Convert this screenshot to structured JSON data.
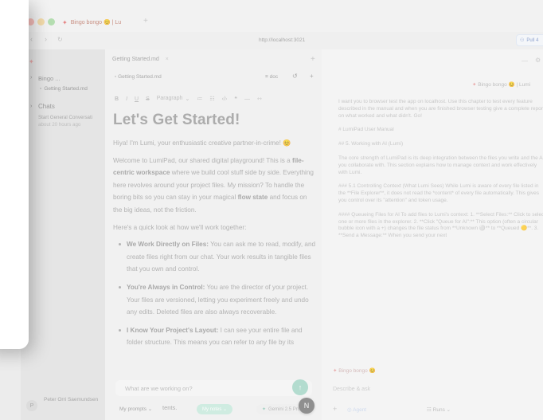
{
  "browser": {
    "tab_title": "Bingo bongo 😊 | Lu",
    "tab_icon": "lumi-icon",
    "url": "http://localhost:3021",
    "open_label": "Pull 4"
  },
  "sidebar": {
    "workspace_label": "Bingo ...",
    "workspace_file": "Getting Started.md",
    "chats_label": "Chats",
    "chat_item_title": "Start General Conversati",
    "chat_item_time": "about 20 hours ago",
    "user_name": "Peter Orri Saemundsen",
    "user_initial": "P"
  },
  "editor": {
    "file_tab": "Getting Started.md",
    "breadcrumb": "Getting Started.md",
    "counter": "≡ doc",
    "toolbar_items": [
      "B",
      "I",
      "U",
      "S",
      "Paragraph",
      "⌄",
      "≔",
      "☷",
      "‹/›",
      "❝",
      "—",
      "⇿"
    ],
    "title": "Let's Get Started!",
    "para1": "Hiya! I'm Lumi, your enthusiastic creative partner-in-crime! 😊",
    "para2_a": "Welcome to LumiPad, our shared digital playground! This is a ",
    "para2_b": "file-centric workspace",
    "para2_c": " where we build cool stuff side by side. Everything here revolves around your project files. My mission? To handle the boring bits so you can stay in your magical ",
    "para2_d": "flow state",
    "para2_e": " and focus on the big ideas, not the friction.",
    "para3": "Here's a quick look at how we'll work together:",
    "points": [
      {
        "bold": "We Work Directly on Files:",
        "text": " You can ask me to read, modify, and create files right from our chat. Your work results in tangible files that you own and control."
      },
      {
        "bold": "You're Always in Control:",
        "text": " You are the director of your project. Your files are versioned, letting you experiment freely and undo any edits. Deleted files are also always recoverable."
      },
      {
        "bold": "I Know Your Project's Layout:",
        "text": " I can see your entire file and folder structure. This means you can refer to any file by its"
      }
    ]
  },
  "chat_bar": {
    "placeholder": "What are we working on?",
    "trailing_text": "tents.",
    "my_prompts": "My prompts",
    "mode_pill": "My notes",
    "model_pill": "Gemini 2.5 Pro",
    "avatar_initial": "N"
  },
  "right_panel": {
    "header": "Bingo bongo 😊 | Lumi",
    "paragraphs": [
      "I want you to browser test the app on localhost. Use this chapter to test every feature described in the manual and when you are finished browser testing give a complete report on what worked and what didn't. Go!",
      "# LumiPad User Manual",
      "## 5. Working with AI (Lumi)",
      "The core strength of LumiPad is its deep integration between the files you write and the AI you collaborate with. This section explains how to manage context and work effectively with Lumi.",
      "### 5.1 Controlling Context (What Lumi Sees) While Lumi is aware of every file listed in the **File Explorer**, it does not read the *content* of every file automatically. This gives you control over its \"attention\" and token usage.",
      "#### Queueing Files for AI To add files to Lumi's context: 1. **Select Files:** Click to select one or more files in the explorer. 2. **Click \"Queue for AI\":** This option (often a circular bubble icon with a +) changes the file status from **Unknown ⚪** to **Queued 🟡**. 3. **Send a Message:** When you send your next"
    ],
    "tag": "Bingo bongo 😊",
    "input_placeholder": "Describe & ask",
    "footer_left": "Agent",
    "footer_right": "Runs"
  }
}
